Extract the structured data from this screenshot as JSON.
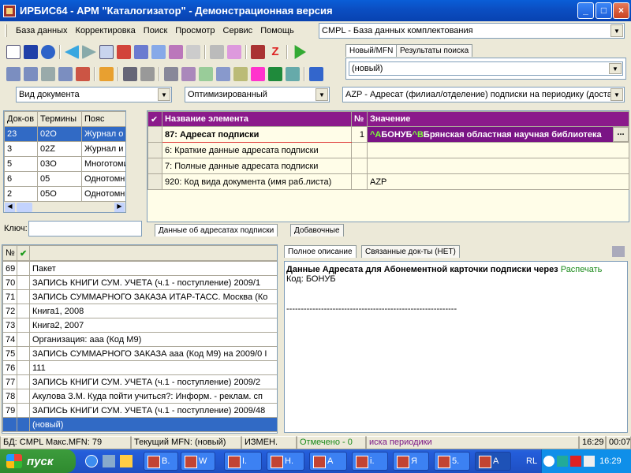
{
  "window": {
    "title": "ИРБИС64 - АРМ \"Каталогизатор\" - Демонстрационная версия",
    "minimize": "_",
    "maximize": "□",
    "close": "×"
  },
  "menu": {
    "items": [
      "База данных",
      "Корректировка",
      "Поиск",
      "Просмотр",
      "Сервис",
      "Помощь"
    ]
  },
  "db_select": {
    "value": "CMPL - База данных комплектования"
  },
  "record_tabs": {
    "new": "Новый/MFN",
    "results": "Результаты поиска"
  },
  "record_select": {
    "value": "(новый)"
  },
  "filters": {
    "doc_type": "Вид документа",
    "mode": "Оптимизированный",
    "worksheet": "AZP - Адресат (филиал/отделение) подписки на периодику (доста"
  },
  "dict_table": {
    "headers": [
      "Док-ов",
      "Термины",
      "Пояс"
    ],
    "rows": [
      {
        "count": "23",
        "term": "02O",
        "desc": "Журнал о"
      },
      {
        "count": "3",
        "term": "02Z",
        "desc": "Журнал и"
      },
      {
        "count": "5",
        "term": "03O",
        "desc": "Многотоми"
      },
      {
        "count": "6",
        "term": "05",
        "desc": "Однотомн"
      },
      {
        "count": "2",
        "term": "05O",
        "desc": "Однотомн"
      }
    ],
    "key_label": "Ключ:",
    "key_value": ""
  },
  "fields_table": {
    "headers": {
      "name": "Название элемента",
      "num": "№",
      "value": "Значение"
    },
    "rows": [
      {
        "name": "87: Адресат подписки",
        "num": "1",
        "value_code1": "^A",
        "value_text1": "БОНУБ",
        "value_code2": "^B",
        "value_text2": "Брянская областная научная библиотека"
      },
      {
        "name": "6: Краткие данные адресата подписки",
        "num": "",
        "value": ""
      },
      {
        "name": "7: Полные данные адресата подписки",
        "num": "",
        "value": ""
      },
      {
        "name": "920: Код вида документа (имя раб.листа)",
        "num": "",
        "value": "AZP"
      }
    ],
    "ellipsis": "...",
    "tabs": [
      "Данные об адресатах подписки",
      "Добавочные"
    ]
  },
  "records_list": {
    "headers": {
      "num": "№"
    },
    "rows": [
      {
        "mfn": "69",
        "text": "Пакет"
      },
      {
        "mfn": "70",
        "text": "ЗАПИСЬ КНИГИ СУМ. УЧЕТА (ч.1 - поступление)  2009/1"
      },
      {
        "mfn": "71",
        "text": "ЗАПИСЬ СУММАРНОГО ЗАКАЗА  ИТАР-ТАСС. Москва (Ко"
      },
      {
        "mfn": "72",
        "text": "Книга1, 2008"
      },
      {
        "mfn": "73",
        "text": "Книга2, 2007"
      },
      {
        "mfn": "74",
        "text": "Организация: ааа (Код М9)"
      },
      {
        "mfn": "75",
        "text": "ЗАПИСЬ СУММАРНОГО ЗАКАЗА  ааа (Код М9) на 2009/0 I"
      },
      {
        "mfn": "76",
        "text": "111"
      },
      {
        "mfn": "77",
        "text": "ЗАПИСЬ КНИГИ СУМ. УЧЕТА (ч.1 - поступление)  2009/2"
      },
      {
        "mfn": "78",
        "text": "Акулова З.М. Куда пойти учиться?: Информ. - реклам. сп"
      },
      {
        "mfn": "79",
        "text": "ЗАПИСЬ КНИГИ СУМ. УЧЕТА (ч.1 - поступление)  2009/48"
      },
      {
        "mfn": "",
        "text": "(новый)"
      }
    ]
  },
  "preview": {
    "tabs": [
      "Полное описание",
      "Связанные док-ты (НЕТ)"
    ],
    "heading": "Данные Адресата для Абонементной карточки подписки через",
    "print_link": "Распечать",
    "code_line": "Код: БОНУБ",
    "rule": "-----------------------------------------------------------"
  },
  "status": {
    "db": "БД: CMPL Макс.MFN: 79",
    "current": "Текущий MFN: (новый)",
    "changed": "ИЗМЕН.",
    "marked": "Отмечено - 0",
    "hint": "иска периодики",
    "time": "16:29",
    "extra": "00:07"
  },
  "taskbar": {
    "start": "пуск",
    "tasks": [
      "В.",
      "W",
      "I.",
      "Н.",
      "А",
      "i.",
      "Я",
      "5.",
      "А"
    ],
    "lang": "RL",
    "clock": "16:29"
  },
  "colors": {
    "accent": "#316ac5",
    "field_highlight": "#7a1485",
    "value_bg": "#fffde8"
  }
}
